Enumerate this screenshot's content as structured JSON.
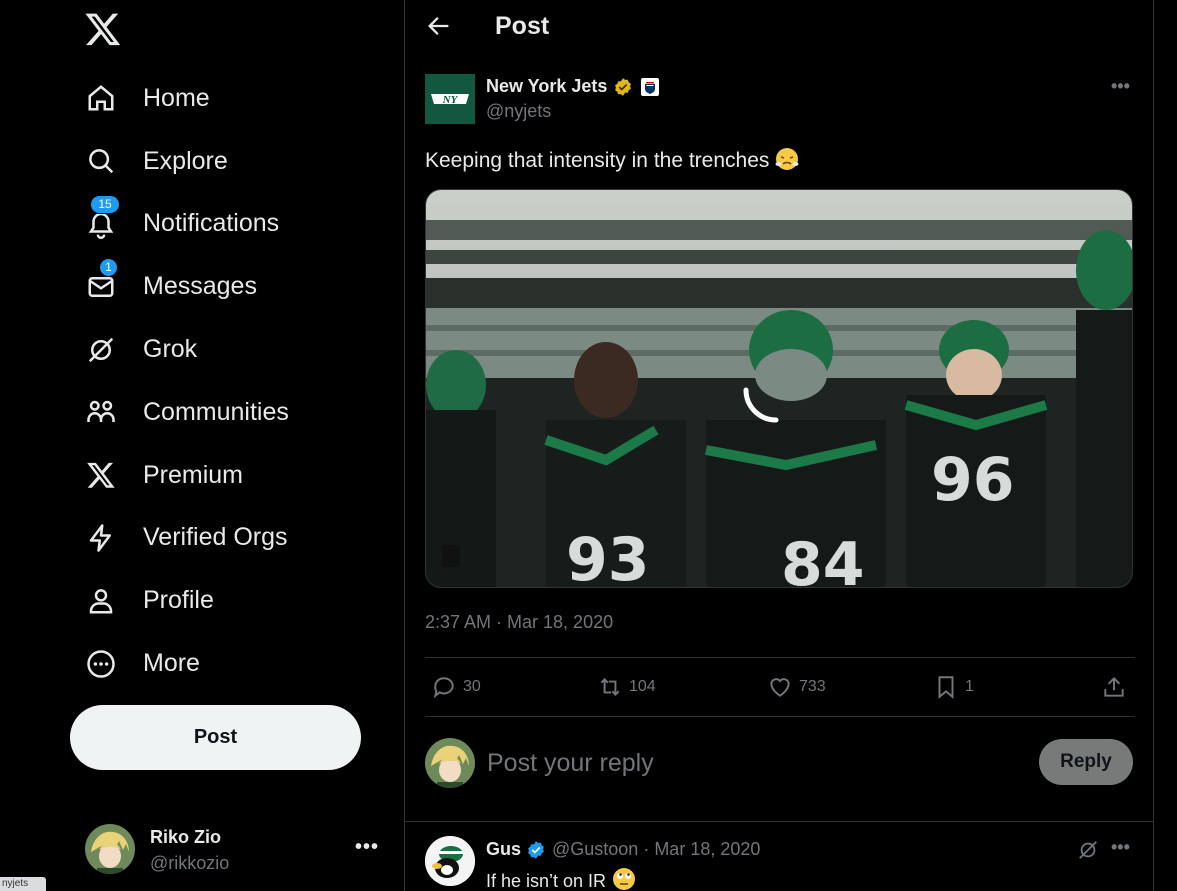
{
  "sidebar": {
    "logo_icon": "x-logo-icon",
    "nav": [
      {
        "label": "Home",
        "icon": "home-icon"
      },
      {
        "label": "Explore",
        "icon": "search-icon"
      },
      {
        "label": "Notifications",
        "icon": "bell-icon",
        "badge": "15"
      },
      {
        "label": "Messages",
        "icon": "mail-icon",
        "badge": "1"
      },
      {
        "label": "Grok",
        "icon": "grok-icon"
      },
      {
        "label": "Communities",
        "icon": "communities-icon"
      },
      {
        "label": "Premium",
        "icon": "x-premium-icon"
      },
      {
        "label": "Verified Orgs",
        "icon": "lightning-icon"
      },
      {
        "label": "Profile",
        "icon": "person-icon"
      },
      {
        "label": "More",
        "icon": "more-circle-icon"
      }
    ],
    "post_button": "Post",
    "account": {
      "name": "Riko Zio",
      "handle": "@rikkozio",
      "more": "•••"
    },
    "status_tip": "nyjets"
  },
  "header": {
    "title": "Post"
  },
  "post": {
    "author": {
      "name": "New York Jets",
      "handle": "@nyjets",
      "avatar_text": "NY"
    },
    "more": "•••",
    "text": "Keeping that intensity in the trenches",
    "emoji": "face-with-steam-icon",
    "timestamp": "2:37 AM · Mar 18, 2020",
    "stats": {
      "replies": "30",
      "reposts": "104",
      "likes": "733",
      "bookmarks": "1"
    }
  },
  "reply_composer": {
    "placeholder": "Post your reply",
    "button": "Reply"
  },
  "comment": {
    "name": "Gus",
    "meta": "@Gustoon · Mar 18, 2020",
    "text": "If he isn’t on IR",
    "more": "•••"
  },
  "colors": {
    "accent": "#1d9bf0",
    "background": "#000000",
    "jets_green": "#125740",
    "verified_gold": "#e2b719"
  }
}
